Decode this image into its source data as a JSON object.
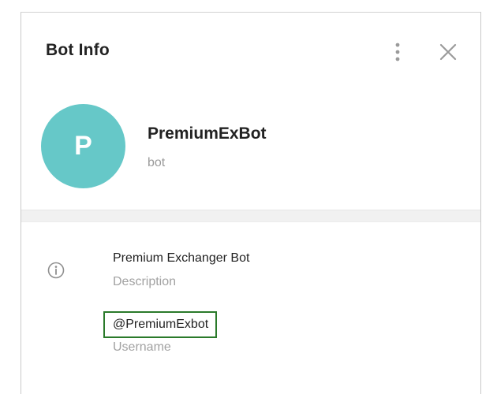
{
  "dialog": {
    "title": "Bot Info",
    "menu_icon": "more-vertical-icon",
    "close_icon": "close-icon"
  },
  "profile": {
    "avatar_letter": "P",
    "avatar_color": "#66c8c8",
    "name": "PremiumExBot",
    "type": "bot"
  },
  "info": {
    "icon": "info-icon",
    "description_value": "Premium Exchanger Bot",
    "description_label": "Description",
    "username_value": "@PremiumExbot",
    "username_label": "Username",
    "highlight_color": "#2a7a2a"
  }
}
